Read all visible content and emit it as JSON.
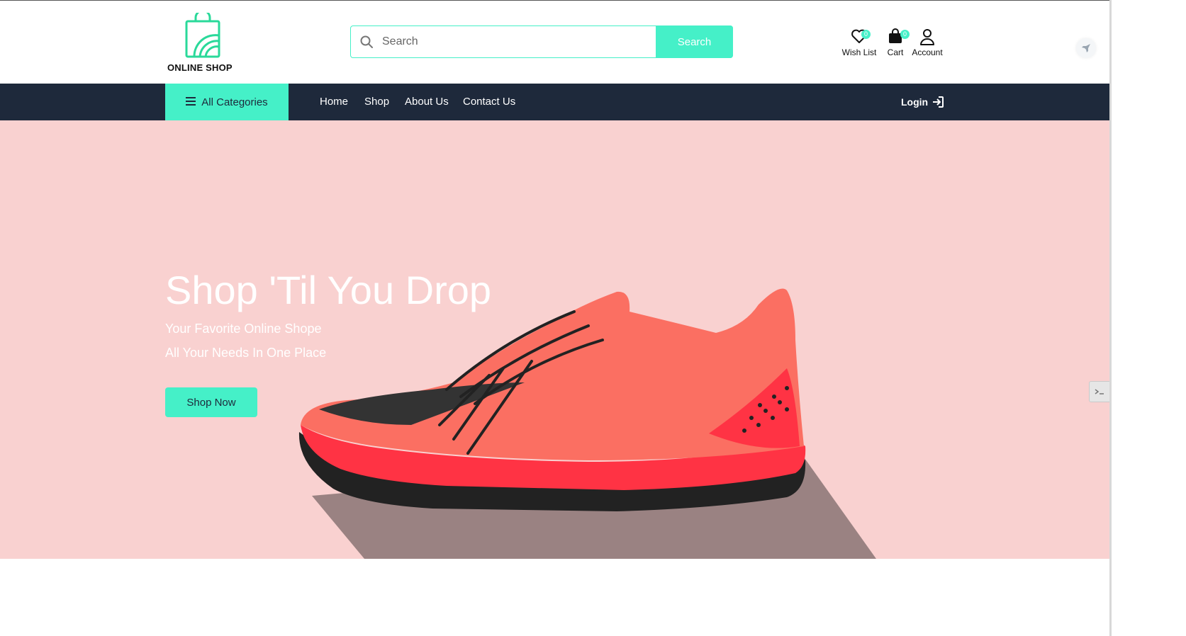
{
  "brand": {
    "name": "ONLINE SHOP",
    "accent_color": "#45f0c8",
    "nav_bg": "#1e293b",
    "hero_bg": "#f9d1d0"
  },
  "search": {
    "placeholder": "Search",
    "button_label": "Search"
  },
  "header_actions": {
    "wishlist": {
      "label": "Wish List",
      "count": "0",
      "icon": "heart-icon"
    },
    "cart": {
      "label": "Cart",
      "count": "0",
      "icon": "shopping-bag-icon"
    },
    "account": {
      "label": "Account",
      "icon": "user-icon"
    }
  },
  "navbar": {
    "categories_label": "All Categories",
    "links": [
      "Home",
      "Shop",
      "About Us",
      "Contact Us"
    ],
    "login_label": "Login"
  },
  "hero": {
    "title": "Shop 'Til You Drop",
    "subtitle_1": "Your Favorite Online Shope",
    "subtitle_2": "All Your Needs In One Place",
    "cta_label": "Shop Now"
  }
}
